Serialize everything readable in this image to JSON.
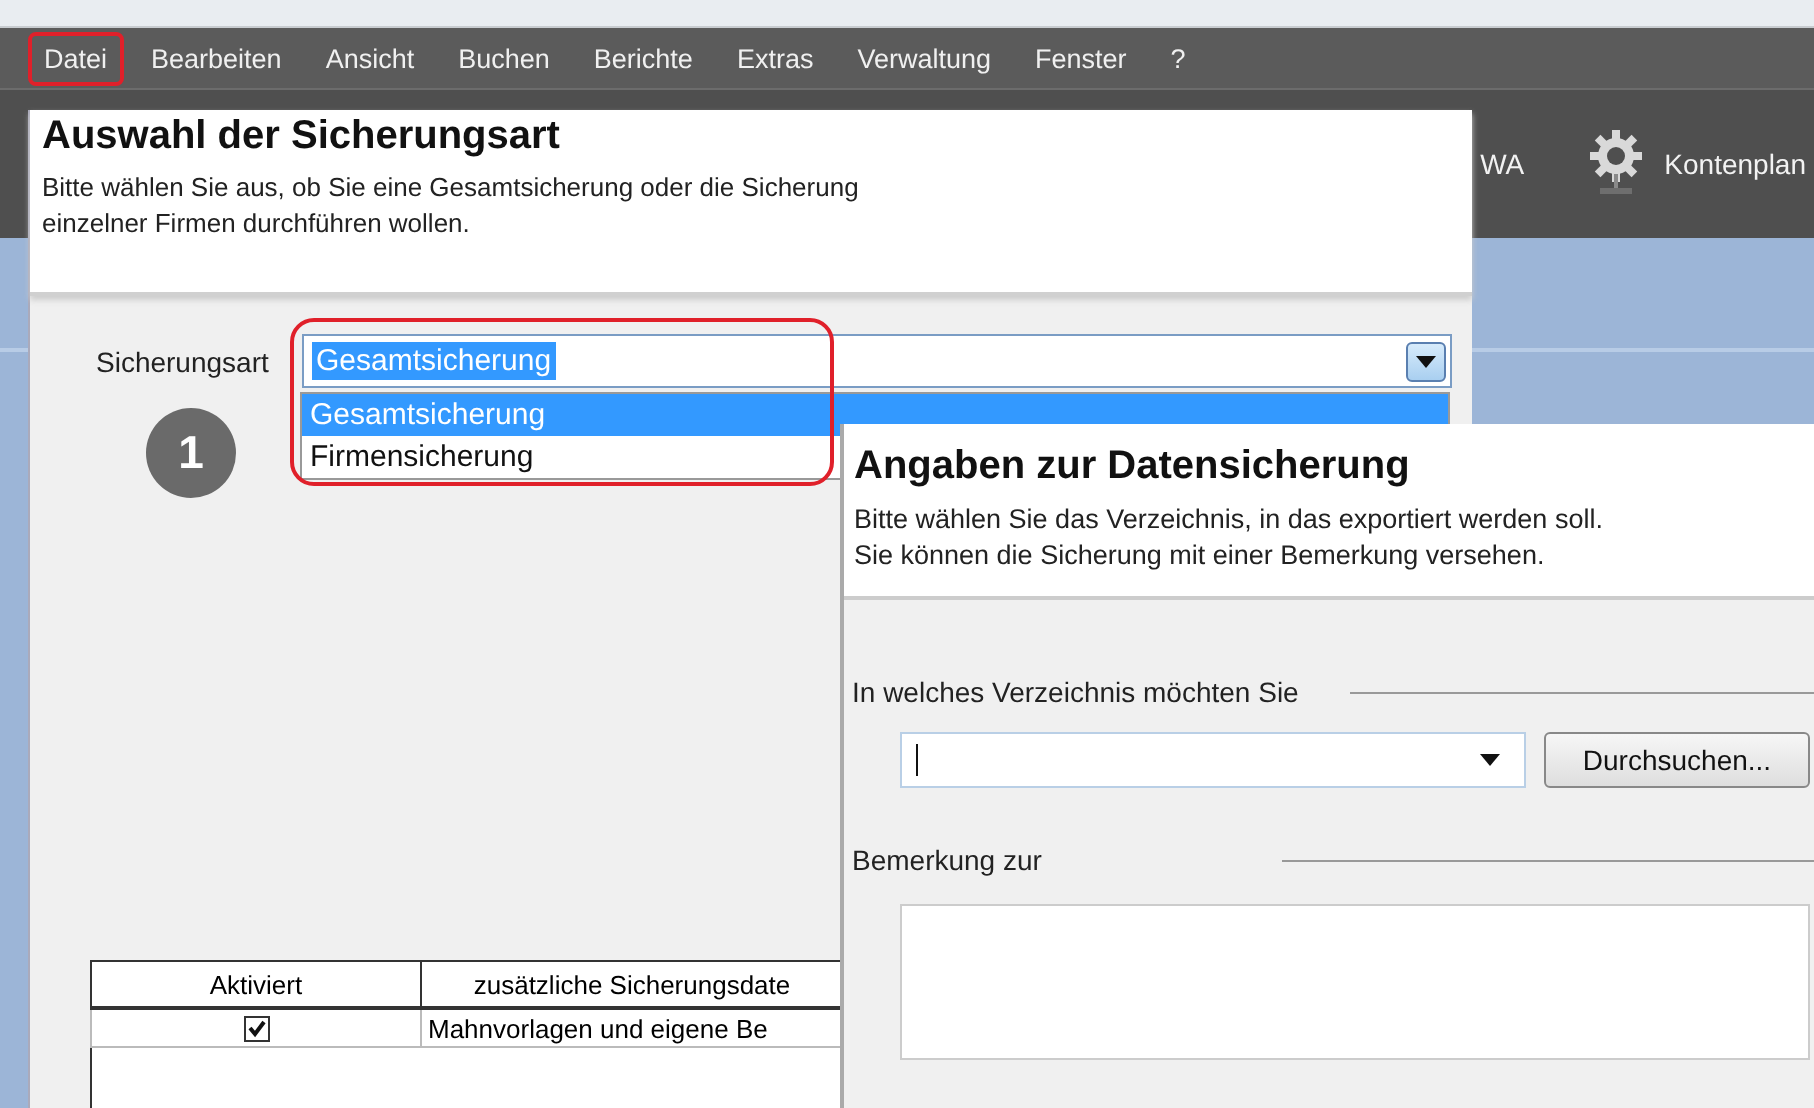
{
  "menu": [
    {
      "label": "Datei",
      "highlighted": true
    },
    {
      "label": "Bearbeiten",
      "highlighted": false
    },
    {
      "label": "Ansicht",
      "highlighted": false
    },
    {
      "label": "Buchen",
      "highlighted": false
    },
    {
      "label": "Berichte",
      "highlighted": false
    },
    {
      "label": "Extras",
      "highlighted": false
    },
    {
      "label": "Verwaltung",
      "highlighted": false
    },
    {
      "label": "Fenster",
      "highlighted": false
    },
    {
      "label": "?",
      "highlighted": false
    }
  ],
  "toolbar": [
    {
      "kind": "text",
      "label": "WA"
    },
    {
      "kind": "gear",
      "label": "Kontenplan"
    }
  ],
  "dialog_1": {
    "title": "Auswahl der Sicherungsart",
    "subtitle_lines": [
      "Bitte wählen Sie aus, ob Sie eine Gesamtsicherung oder die Sicherung",
      "einzelner Firmen durchführen wollen."
    ],
    "field_label": "Sicherungsart",
    "value": "Gesamtsicherung",
    "highlighted": true,
    "options": [
      {
        "label": "Gesamtsicherung",
        "selected": true
      },
      {
        "label": "Firmensicherung",
        "selected": false
      }
    ],
    "step_badge": "1",
    "table": {
      "columns": [
        "Aktiviert",
        "zusätzliche Sicherungsdate"
      ],
      "rows": [
        {
          "checked": true,
          "text": "Mahnvorlagen und eigene Be"
        }
      ]
    }
  },
  "dialog_2": {
    "title": "Angaben zur Datensicherung",
    "subtitle_lines": [
      "Bitte wählen Sie das Verzeichnis, in das exportiert werden soll.",
      "Sie können die Sicherung mit einer Bemerkung versehen."
    ],
    "directory_label": "In welches Verzeichnis möchten Sie",
    "browse_button": "Durchsuchen...",
    "remark_label": "Bemerkung zur"
  }
}
